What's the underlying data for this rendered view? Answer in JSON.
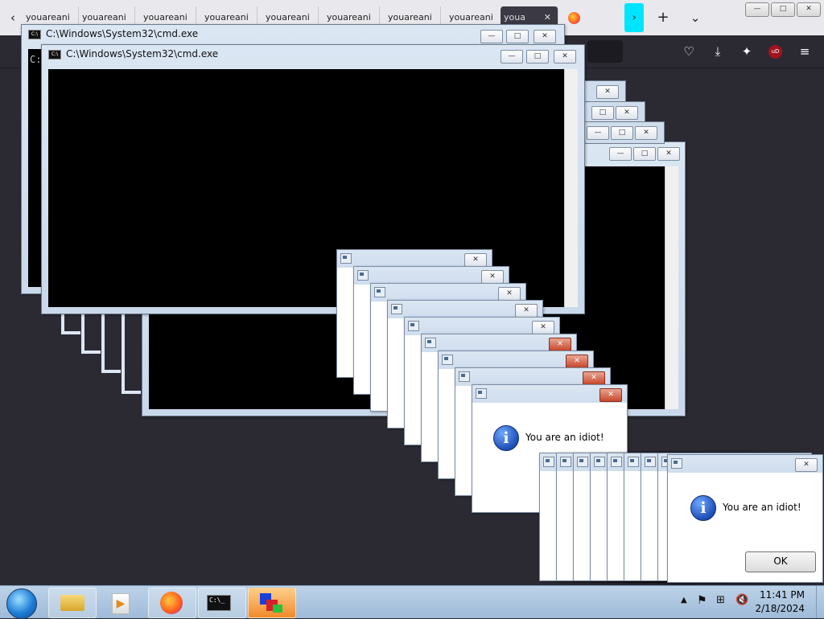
{
  "browser": {
    "tabs": [
      {
        "label": "youareani"
      },
      {
        "label": "youareani"
      },
      {
        "label": "youareani"
      },
      {
        "label": "youareani"
      },
      {
        "label": "youareani"
      },
      {
        "label": "youareani"
      },
      {
        "label": "youareani"
      },
      {
        "label": "youareani"
      },
      {
        "label": "youa",
        "active": true
      }
    ],
    "tab_close": "✕",
    "icons": [
      "back-icon",
      "firefox-icon",
      "list-all-tabs-icon",
      "new-tab-icon",
      "tab-list-chevron-icon",
      "pocket-icon",
      "download-icon",
      "extensions-icon",
      "ublock-icon",
      "menu-icon"
    ],
    "ublock_badge": "uD"
  },
  "cmd_windows": [
    {
      "title": "C:\\Windows\\System32\\cmd.exe",
      "prompt": "C:"
    },
    {
      "title": "C:\\Windows\\System32\\cmd.exe"
    }
  ],
  "caption_buttons": {
    "minimize": "—",
    "maximize": "□",
    "close": "✕"
  },
  "message_box": {
    "text": "You are an idiot!",
    "ok_label": "OK",
    "info_glyph": "i"
  },
  "taskbar": {
    "time": "11:41 PM",
    "date": "2/18/2024",
    "pinned": [
      "file-explorer-icon",
      "media-player-icon",
      "firefox-icon",
      "cmd-icon",
      "paint3d-icon"
    ],
    "cmd_label": "C:\\_"
  },
  "colors": {
    "accent_close": "#c8482c",
    "cmd_bg": "#000000",
    "title_bar": "#dbe6f3"
  }
}
